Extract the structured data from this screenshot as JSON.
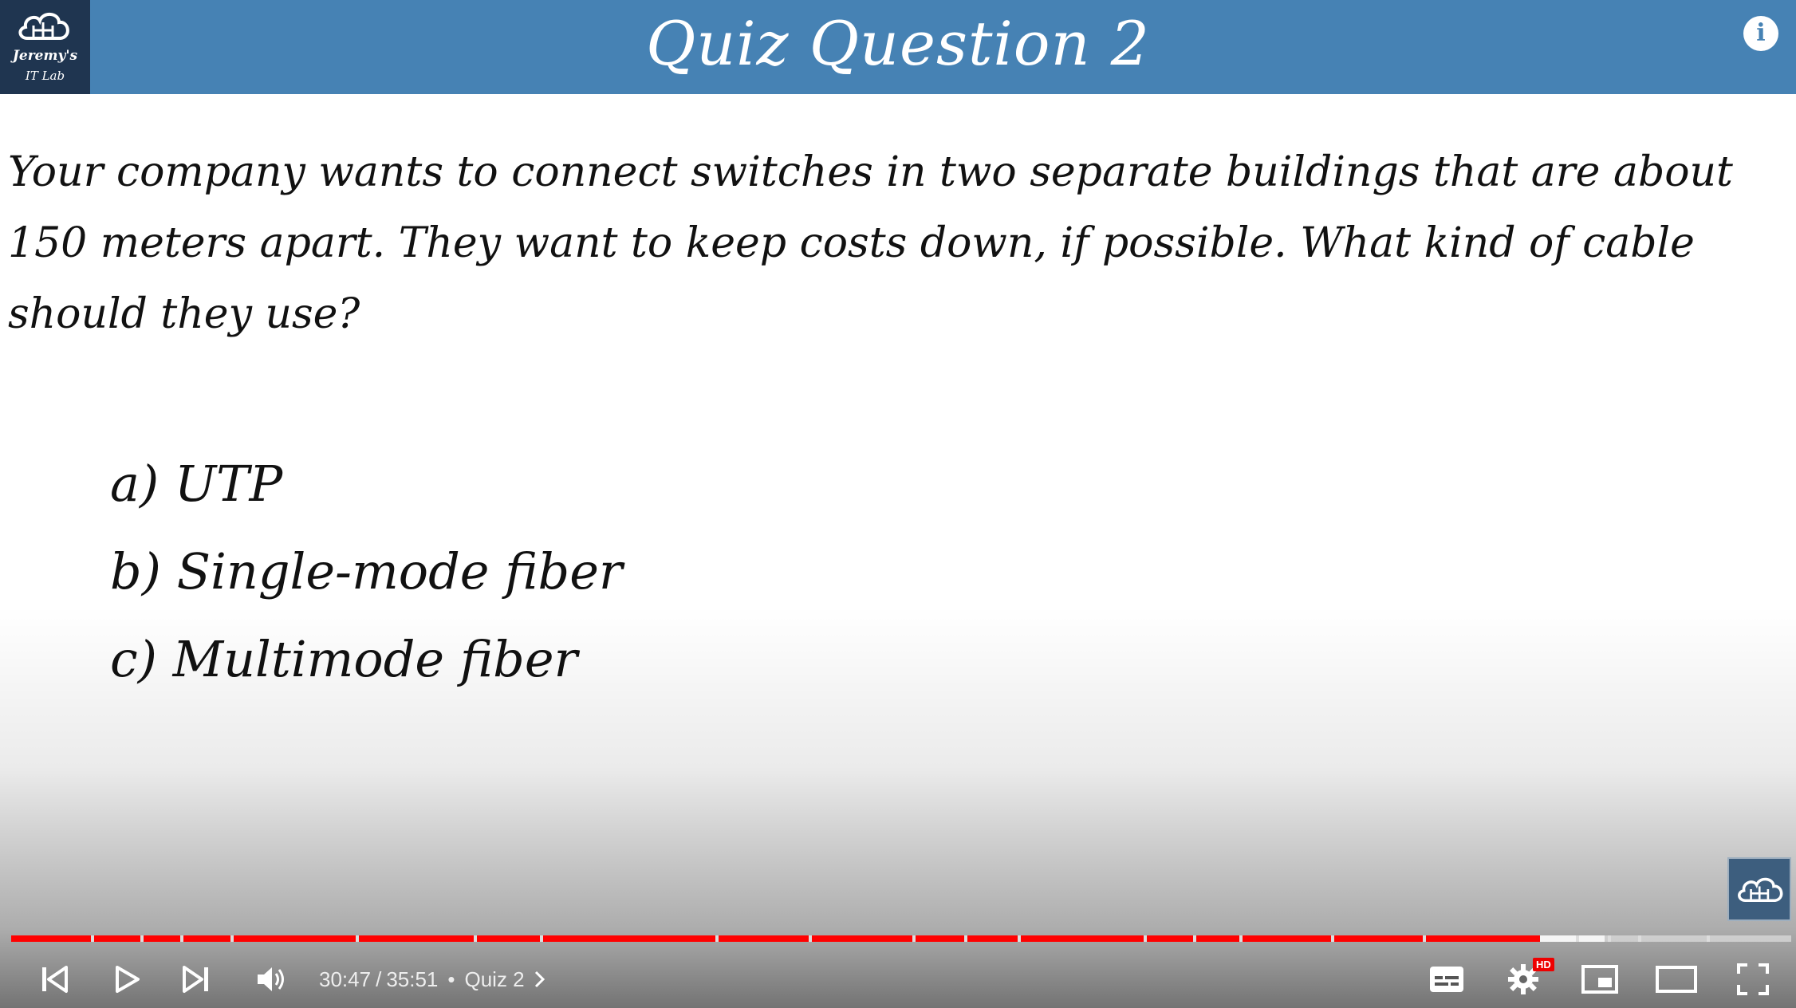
{
  "slide": {
    "logo_line1": "Jeremy's",
    "logo_line2": "IT Lab",
    "title": "Quiz Question 2",
    "question_lines": [
      "Your company wants to connect switches in two separate buildings that are about",
      "150 meters apart.  They want to keep costs down, if possible.  What kind of cable",
      "should they use?"
    ],
    "answers": [
      "a) UTP",
      "b) Single-mode fiber",
      "c) Multimode fiber"
    ]
  },
  "player": {
    "current_time": "30:47",
    "duration": "35:51",
    "time_separator": "/",
    "chapter_bullet": "•",
    "chapter_label": "Quiz 2",
    "hd_badge": "HD",
    "progress_played_fraction": 0.859,
    "progress_buffered_fraction": 0.895,
    "icons": [
      "previous-icon",
      "play-icon",
      "next-icon",
      "volume-icon",
      "chevron-right-icon",
      "subtitles-icon",
      "settings-gear-icon",
      "miniplayer-icon",
      "theater-mode-icon",
      "fullscreen-icon",
      "info-icon",
      "channel-watermark-icon"
    ],
    "accent_color": "#ff0000",
    "header_color": "#4682b4"
  }
}
